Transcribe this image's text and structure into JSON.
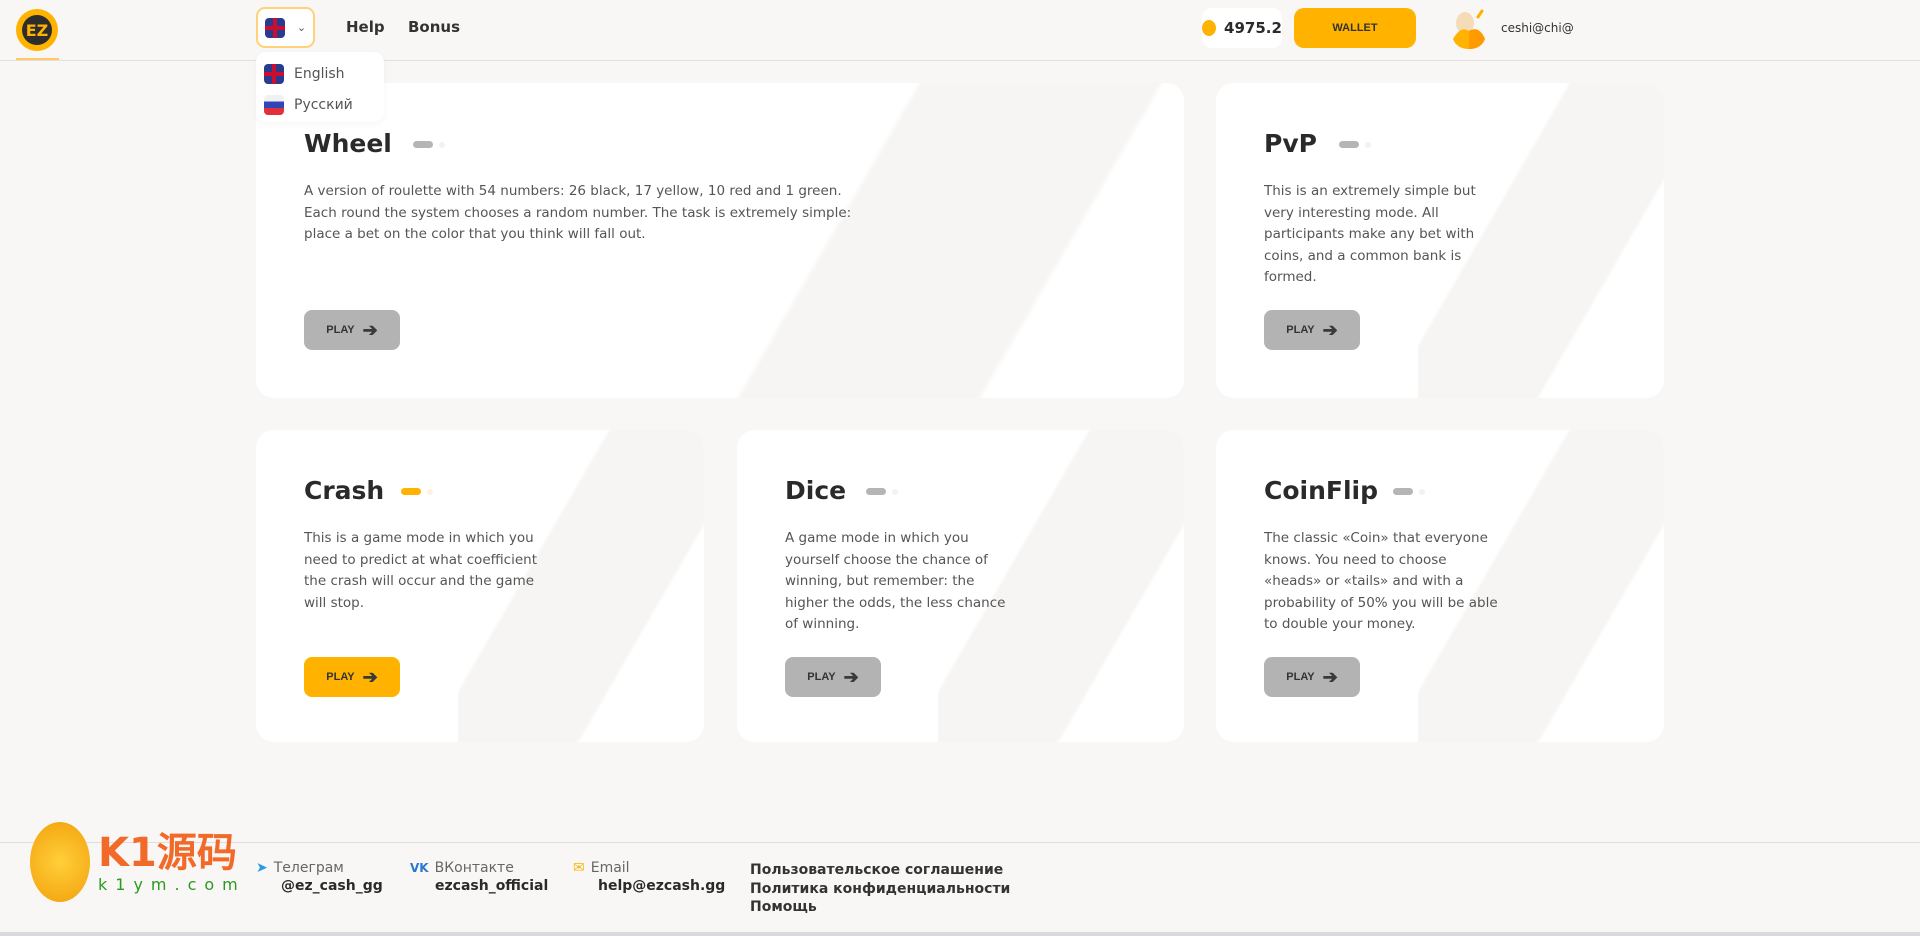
{
  "header": {
    "logo": "EZ",
    "nav": [
      "Help",
      "Bonus"
    ],
    "balance": "4975.2",
    "wallet_label": "WALLET",
    "user": "ceshi@chi@"
  },
  "language": {
    "current": "English",
    "options": [
      "English",
      "Русский"
    ]
  },
  "games": [
    {
      "title": "Wheel",
      "desc": "A version of roulette with 54 numbers: 26 black, 17 yellow, 10 red and 1 green. Each round the system chooses a random number. The task is extremely simple: place a bet on the color that you think will fall out.",
      "play": "PLAY"
    },
    {
      "title": "PvP",
      "desc": "This is an extremely simple but very interesting mode. All participants make any bet with coins, and a common bank is formed.",
      "play": "PLAY"
    },
    {
      "title": "Crash",
      "desc": "This is a game mode in which you need to predict at what coefficient the crash will occur and the game will stop.",
      "play": "PLAY"
    },
    {
      "title": "Dice",
      "desc": "A game mode in which you yourself choose the chance of winning, but remember: the higher the odds, the less chance of winning.",
      "play": "PLAY"
    },
    {
      "title": "CoinFlip",
      "desc": "The classic «Coin» that everyone knows. You need to choose «heads» or «tails» and with a probability of 50% you will be able to double your money.",
      "play": "PLAY"
    }
  ],
  "footer": {
    "telegram": {
      "label": "Телеграм",
      "value": "@ez_cash_gg"
    },
    "vk": {
      "label": "ВКонтакте",
      "value": "ezcash_official"
    },
    "email": {
      "label": "Email",
      "value": "help@ezcash.gg"
    },
    "links": [
      "Пользовательское соглашение",
      "Политика конфиденциальности",
      "Помощь"
    ]
  },
  "watermark": {
    "main": "K1源码",
    "sub": "k1ym.com"
  },
  "colors": {
    "accent": "#ffb300",
    "inactive": "#b3b3b3"
  }
}
